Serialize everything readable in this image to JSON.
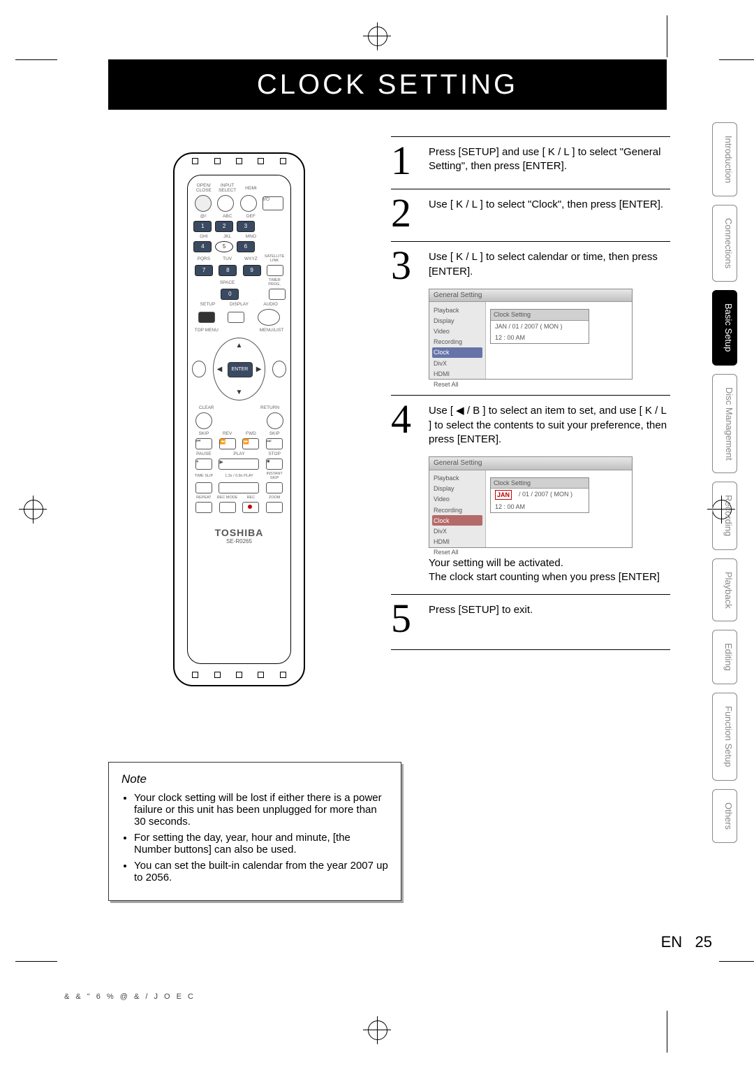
{
  "page_title": "CLOCK SETTING",
  "side_tabs": [
    {
      "label": "Introduction",
      "active": false
    },
    {
      "label": "Connections",
      "active": false
    },
    {
      "label": "Basic Setup",
      "active": true
    },
    {
      "label": "Disc Management",
      "active": false,
      "multi": true
    },
    {
      "label": "Recording",
      "active": false
    },
    {
      "label": "Playback",
      "active": false
    },
    {
      "label": "Editing",
      "active": false
    },
    {
      "label": "Function Setup",
      "active": false
    },
    {
      "label": "Others",
      "active": false
    }
  ],
  "remote": {
    "brand": "TOSHIBA",
    "model": "SE-R0265",
    "labels": {
      "open_close": "OPEN/\nCLOSE",
      "input_select": "INPUT\nSELECT",
      "hdmi": "HDMI",
      "power": "I/⏻",
      "at": "@/:",
      "abc": "ABC",
      "def": "DEF",
      "ghi": "GHI",
      "jkl": "JKL",
      "mno": "MNO",
      "pqrs": "PQRS",
      "tuv": "TUV",
      "wxyz": "WXYZ",
      "sat": "SATELLITE\nLINK",
      "space": "SPACE",
      "timer": "TIMER\nPROG.",
      "setup": "SETUP",
      "display": "DISPLAY",
      "audio": "AUDIO",
      "topmenu": "TOP MENU",
      "menulist": "MENU/LIST",
      "enter": "ENTER",
      "clear": "CLEAR",
      "return": "RETURN",
      "skip_l": "SKIP",
      "rev": "REV",
      "fwd": "FWD",
      "skip_r": "SKIP",
      "pause": "PAUSE",
      "play": "PLAY",
      "stop": "STOP",
      "timeslip": "TIME SLIP",
      "xplay": "1.3x / 0.8x PLAY",
      "instant": "INSTANT SKIP",
      "repeat": "REPEAT",
      "recmode": "REC MODE",
      "rec": "REC",
      "zoom": "ZOOM"
    },
    "nums": [
      "1",
      "2",
      "3",
      "4",
      "5",
      "6",
      "7",
      "8",
      "9",
      "0"
    ]
  },
  "steps": [
    {
      "num": "1",
      "text": "Press [SETUP] and use [ K / L ] to select \"General Setting\", then press [ENTER]."
    },
    {
      "num": "2",
      "text": "Use [ K / L ] to select \"Clock\", then press [ENTER]."
    },
    {
      "num": "3",
      "text": "Use [ K / L ] to select calendar or time, then press [ENTER].",
      "osd": {
        "title": "General Setting",
        "left_items": [
          "Playback",
          "Display",
          "Video",
          "Recording",
          "Clock",
          "DivX",
          "HDMI",
          "Reset All"
        ],
        "active_idx": 4,
        "sel_class": "sel",
        "box": {
          "title": "Clock Setting",
          "rows": [
            [
              "JAN / 01 / 2007 ( MON )"
            ],
            [
              "12 : 00 AM"
            ]
          ],
          "highlight": null
        }
      }
    },
    {
      "num": "4",
      "text": "Use [ ◀ / B ] to select an item to set, and use [ K / L ] to select the contents to suit your preference, then press [ENTER].",
      "osd": {
        "title": "General Setting",
        "left_items": [
          "Playback",
          "Display",
          "Video",
          "Recording",
          "Clock",
          "DivX",
          "HDMI",
          "Reset All"
        ],
        "active_idx": 4,
        "sel_class": "selr",
        "box": {
          "title": "Clock Setting",
          "rows": [
            [
              "JAN",
              "/ 01 / 2007 ( MON )"
            ],
            [
              "12 : 00 AM"
            ]
          ],
          "highlight": "first-red"
        }
      },
      "after": [
        "Your setting will be activated.",
        "The clock start counting when you press [ENTER]"
      ]
    },
    {
      "num": "5",
      "text": "Press [SETUP] to exit."
    }
  ],
  "note": {
    "title": "Note",
    "items": [
      "Your clock setting will be lost if either there is a power failure or this unit has been unplugged for more than 30 seconds.",
      "For setting the day, year, hour and minute, [the Number buttons] can also be used.",
      "You can set the built-in calendar from the year 2007 up to 2056."
    ]
  },
  "page_number": {
    "lang": "EN",
    "num": "25"
  },
  "footer_code": "& & \" 6 % @ & /  J O E C"
}
